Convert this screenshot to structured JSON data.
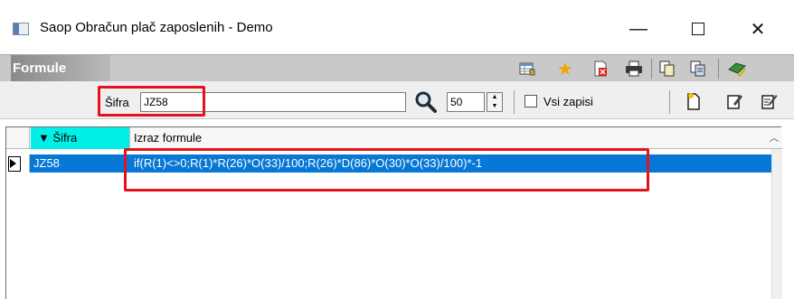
{
  "window": {
    "title": "Saop Obračun plač zaposlenih - Demo",
    "minimize_glyph": "—",
    "close_glyph": "✕"
  },
  "header": {
    "title": "Formule"
  },
  "filter": {
    "sifra_label": "Šifra",
    "sifra_value": "JZ58",
    "count_value": "50",
    "all_records_label": "Vsi zapisi",
    "all_records_checked": false
  },
  "grid": {
    "columns": [
      {
        "label": "▼ Šifra",
        "sorted": true
      },
      {
        "label": "Izraz formule",
        "sorted": false
      }
    ],
    "rows": [
      {
        "sifra": "JZ58",
        "izraz": "if(R(1)<>0;R(1)*R(26)*O(33)/100;R(26)*D(86)*O(30)*O(33)/100)*-1",
        "selected": true
      }
    ]
  },
  "icons": {
    "header_toolbar": [
      "table-settings-icon",
      "favorite-star-icon",
      "delete-icon",
      "print-icon",
      "copy-icon",
      "paste-icon",
      "export-icon"
    ],
    "filter_toolbar": [
      "search-icon",
      "new-record-icon",
      "edit-record-icon",
      "edit-multiple-icon"
    ]
  },
  "colors": {
    "selected_row": "#0778d6",
    "sort_column": "#00f0e8",
    "highlight_box": "#e3121b",
    "header_strip": "#c9c9c9"
  }
}
